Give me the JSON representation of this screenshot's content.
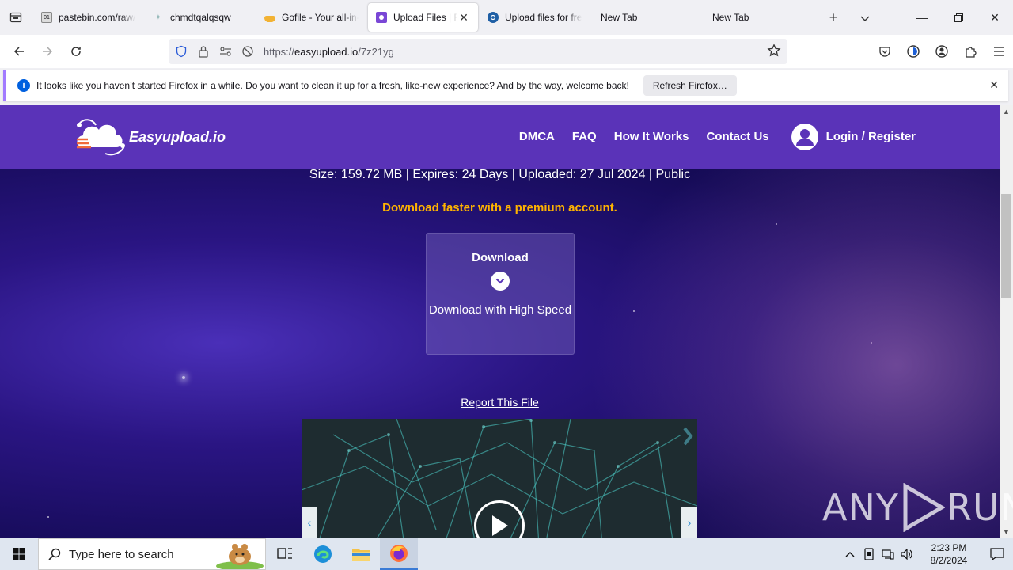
{
  "browser": {
    "tabs": [
      {
        "title": "pastebin.com/raw/...",
        "favicon": "pastebin-icon"
      },
      {
        "title": "chmdtqalqsqw",
        "favicon": "loading-icon"
      },
      {
        "title": "Gofile - Your all-in-one",
        "favicon": "gofile-icon"
      },
      {
        "title": "Upload Files | Free",
        "favicon": "easyupload-icon",
        "active": true
      },
      {
        "title": "Upload files for free",
        "favicon": "upload-icon"
      },
      {
        "title": "New Tab",
        "favicon": ""
      },
      {
        "title": "New Tab",
        "favicon": ""
      }
    ],
    "url_prefix": "https://",
    "url_host": "easyupload.io",
    "url_path": "/7z21yg"
  },
  "notification": {
    "message": "It looks like you haven’t started Firefox in a while. Do you want to clean it up for a fresh, like-new experience? And by the way, welcome back!",
    "button": "Refresh Firefox…"
  },
  "site": {
    "logo_text": "Easyupload.io",
    "nav": [
      "DMCA",
      "FAQ",
      "How It Works",
      "Contact Us"
    ],
    "login": "Login / Register",
    "file_meta": "Size: 159.72 MB | Expires: 24 Days | Uploaded: 27 Jul 2024 | Public",
    "premium": "Download faster with a premium account.",
    "download_title": "Download",
    "download_sub": "Download with High Speed",
    "report": "Report This File"
  },
  "watermark": {
    "left": "ANY",
    "right": "RUN"
  },
  "taskbar": {
    "search_placeholder": "Type here to search",
    "time": "2:23 PM",
    "date": "8/2/2024"
  },
  "colors": {
    "header": "#5a33b8",
    "premium": "#ffb300",
    "accent": "#0060df"
  }
}
